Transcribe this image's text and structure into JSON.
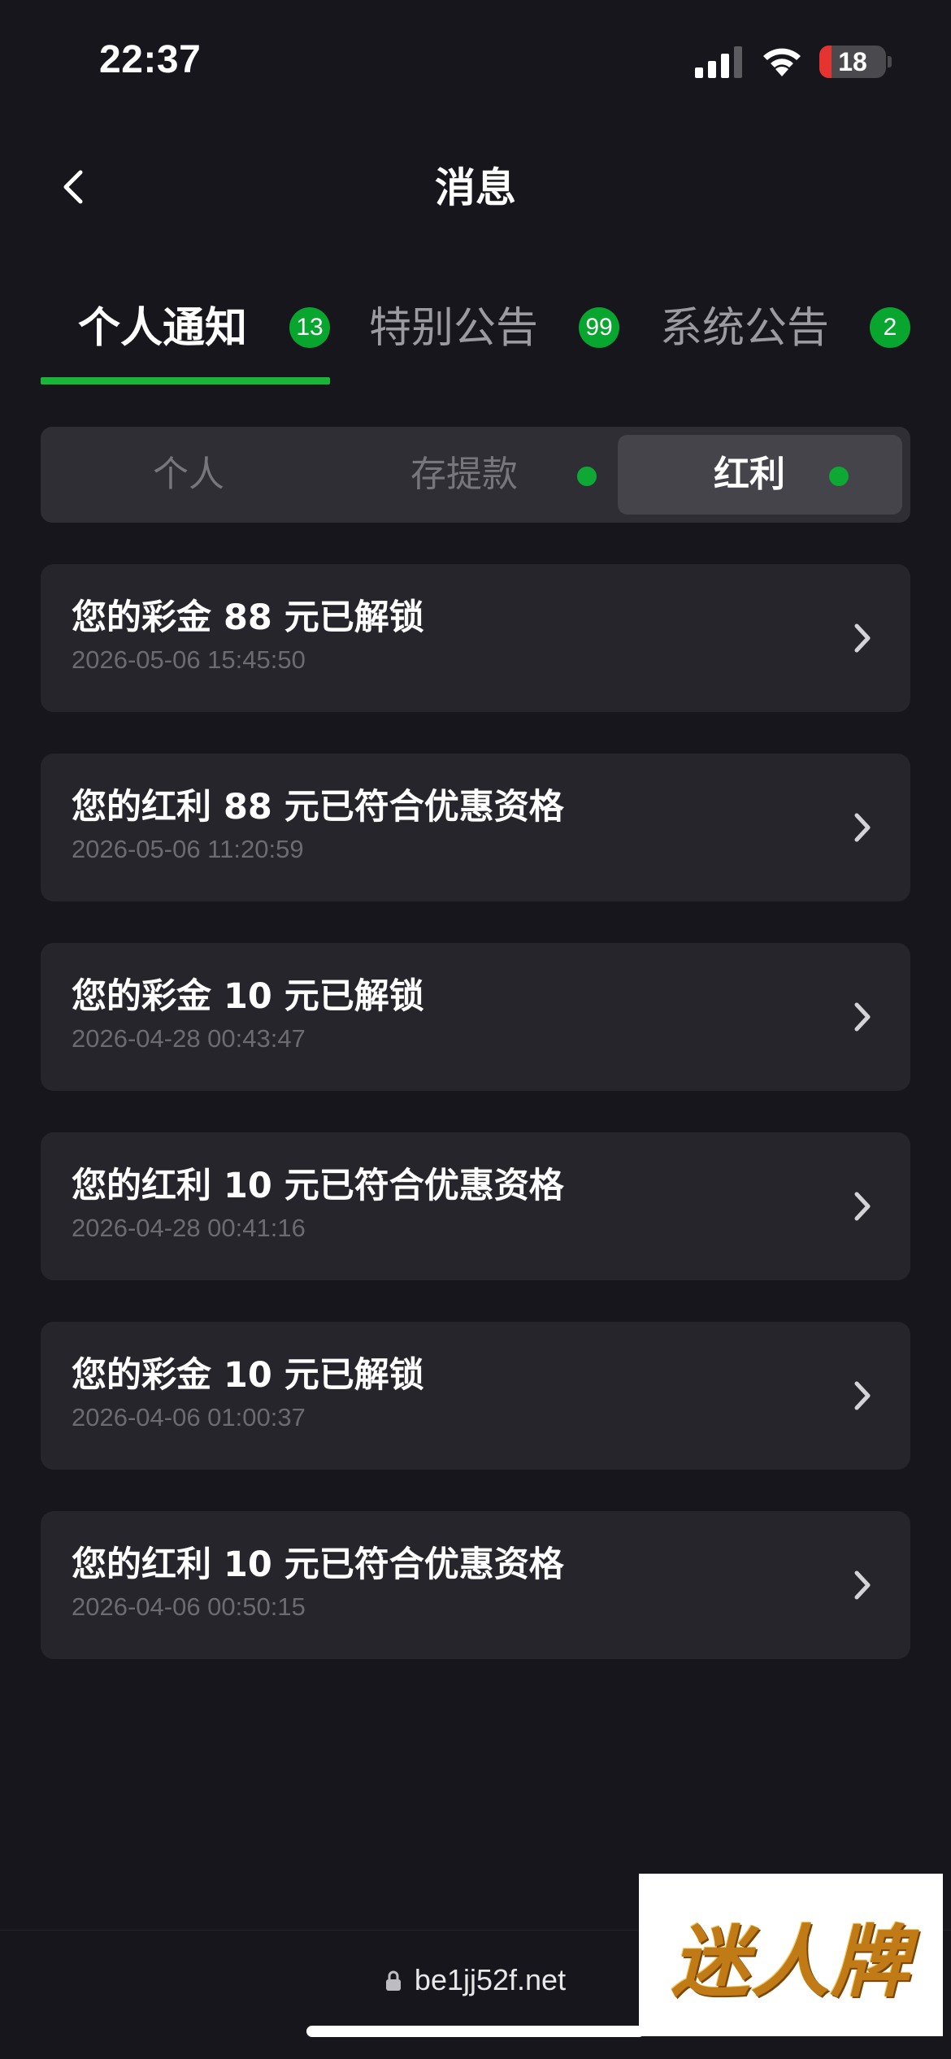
{
  "status_bar": {
    "time": "22:37",
    "battery": "18",
    "battery_level": 0.18,
    "signal_icon": "cellular-signal-icon",
    "wifi_icon": "wifi-icon"
  },
  "header": {
    "title": "消息",
    "back_icon": "chevron-left-icon"
  },
  "tabs": [
    {
      "label": "个人通知",
      "badge": "13",
      "active": true
    },
    {
      "label": "特别公告",
      "badge": "99",
      "active": false
    },
    {
      "label": "系统公告",
      "badge": "2",
      "active": false
    }
  ],
  "subtabs": [
    {
      "label": "个人",
      "has_dot": false,
      "active": false
    },
    {
      "label": "存提款",
      "has_dot": true,
      "active": false
    },
    {
      "label": "红利",
      "has_dot": true,
      "active": true
    }
  ],
  "messages": [
    {
      "title": "您的彩金 88 元已解锁",
      "time": "2026-05-06 15:45:50"
    },
    {
      "title": "您的红利 88 元已符合优惠资格",
      "time": "2026-05-06 11:20:59"
    },
    {
      "title": "您的彩金 10 元已解锁",
      "time": "2026-04-28 00:43:47"
    },
    {
      "title": "您的红利 10 元已符合优惠资格",
      "time": "2026-04-28 00:41:16"
    },
    {
      "title": "您的彩金 10 元已解锁",
      "time": "2026-04-06 01:00:37"
    },
    {
      "title": "您的红利 10 元已符合优惠资格",
      "time": "2026-04-06 00:50:15"
    }
  ],
  "browser": {
    "url": "be1jj52f.net",
    "lock_icon": "lock-icon"
  },
  "watermark": {
    "text": "迷人牌"
  },
  "colors": {
    "background": "#17161c",
    "card": "#26252b",
    "accent_green": "#18b536",
    "badge_green": "#08a52f",
    "battery_red": "#e5332f"
  }
}
